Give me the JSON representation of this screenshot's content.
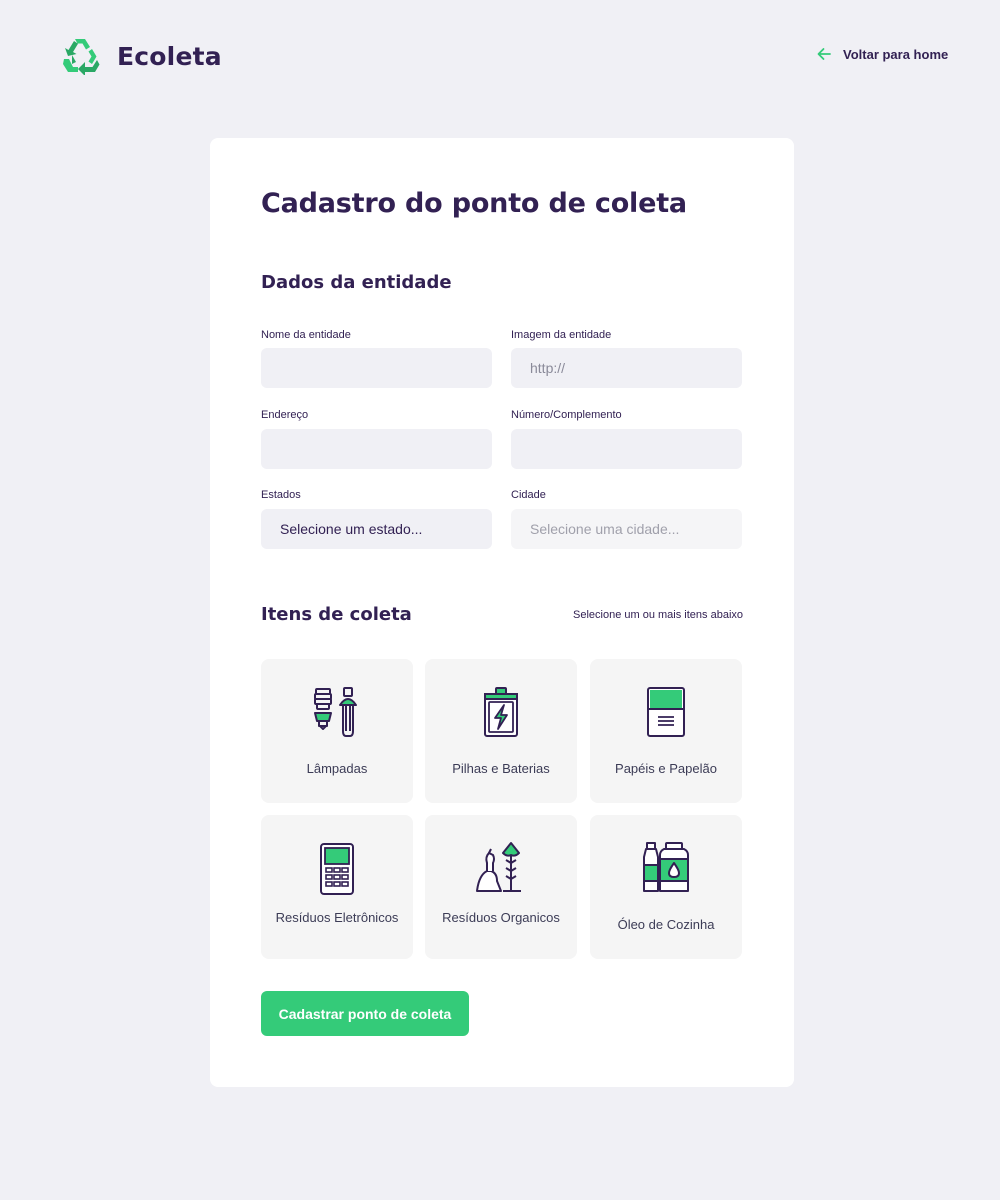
{
  "brand": {
    "name": "Ecoleta",
    "accent": "#34cb79",
    "dark": "#322153"
  },
  "header": {
    "back_label": "Voltar para home"
  },
  "form": {
    "title": "Cadastro do ponto de coleta",
    "entity_section": "Dados da entidade",
    "fields": {
      "name_label": "Nome da entidade",
      "name_value": "",
      "image_label": "Imagem da entidade",
      "image_placeholder": "http://",
      "address_label": "Endereço",
      "address_value": "",
      "number_label": "Número/Complemento",
      "number_value": "",
      "state_label": "Estados",
      "state_selected": "Selecione um estado...",
      "city_label": "Cidade",
      "city_selected": "Selecione uma cidade..."
    },
    "items_section": "Itens de coleta",
    "items_hint": "Selecione um ou mais itens abaixo",
    "items": [
      {
        "label": "Lâmpadas",
        "icon": "lamp-icon"
      },
      {
        "label": "Pilhas e Baterias",
        "icon": "battery-icon"
      },
      {
        "label": "Papéis e Papelão",
        "icon": "paper-icon"
      },
      {
        "label": "Resíduos Eletrônicos",
        "icon": "electronics-icon"
      },
      {
        "label": "Resíduos Organicos",
        "icon": "organic-icon"
      },
      {
        "label": "Óleo de Cozinha",
        "icon": "cooking-oil-icon"
      }
    ],
    "submit_label": "Cadastrar ponto de coleta"
  }
}
